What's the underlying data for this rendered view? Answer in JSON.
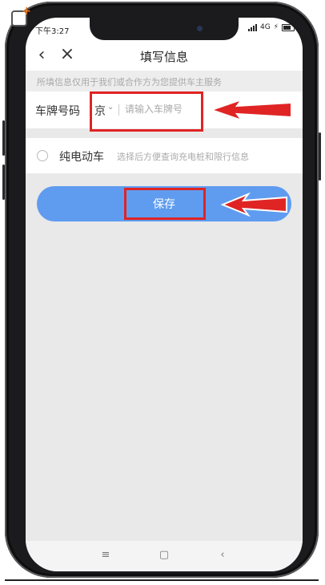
{
  "status_bar": {
    "time": "下午3:27",
    "network": "4G"
  },
  "header": {
    "title": "填写信息",
    "back_icon": "chevron-left-icon",
    "close_icon": "close-icon"
  },
  "notice": "所填信息仅用于我们或合作方为您提供车主服务",
  "plate": {
    "label": "车牌号码",
    "province": "京",
    "placeholder": "请输入车牌号"
  },
  "ev_option": {
    "label": "纯电动车",
    "hint": "选择后方便查询充电桩和限行信息"
  },
  "save_button": {
    "label": "保存",
    "color": "#5f9cf0"
  },
  "annotation_color": "#e02424"
}
